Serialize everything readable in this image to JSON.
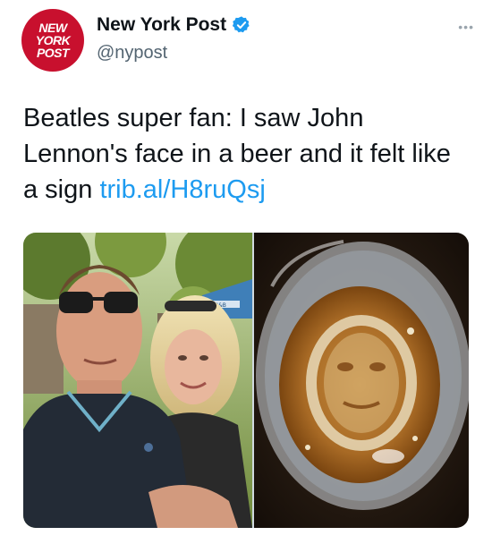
{
  "author": {
    "avatar_text": [
      "NEW",
      "YORK",
      "POST"
    ],
    "display_name": "New York Post",
    "handle": "@nypost",
    "verified": true,
    "brand_color": "#c8102e",
    "verified_color": "#1d9bf0"
  },
  "menu_icon": "more-icon",
  "tweet": {
    "text_before_link": "Beatles super fan: I saw John Lennon's face in a beer and it felt like a sign ",
    "link_text": "trib.al/H8ruQsj",
    "link_color": "#1d9bf0"
  },
  "media": {
    "count": 2,
    "sign_text": "B&B"
  }
}
